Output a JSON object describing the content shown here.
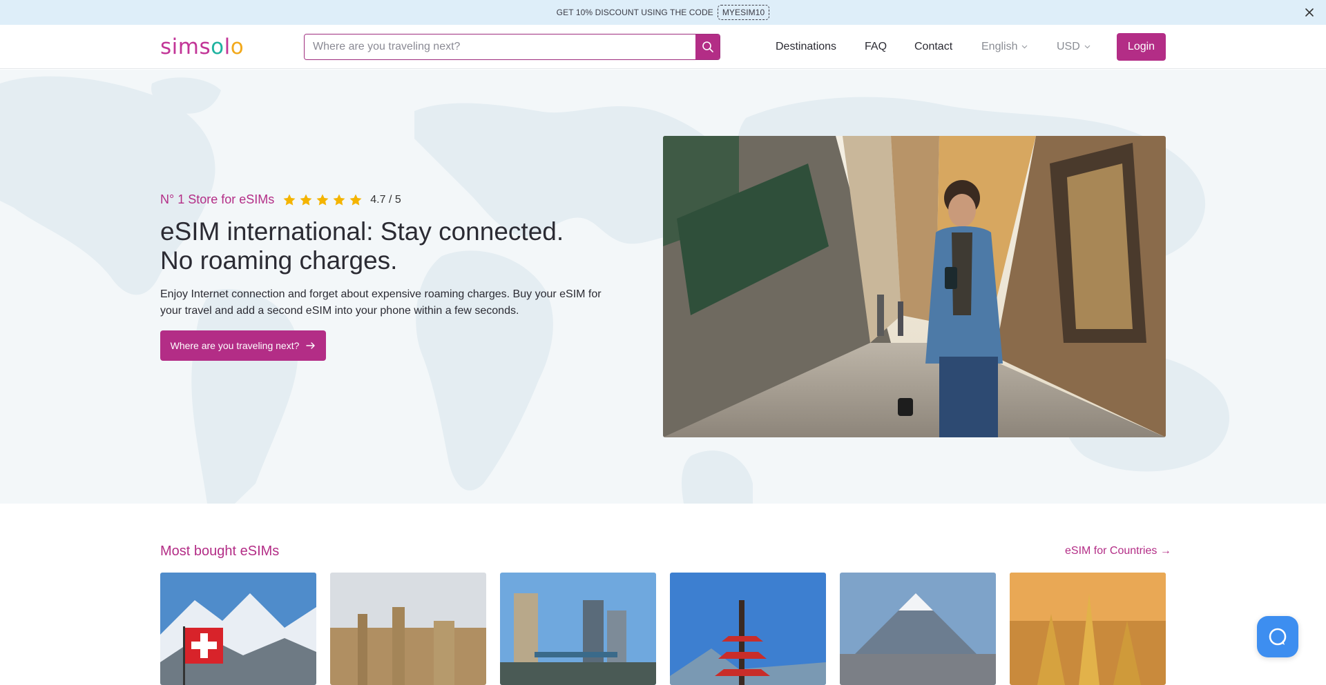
{
  "promo": {
    "text": "GET 10% DISCOUNT USING THE CODE",
    "code": "MYESIM10"
  },
  "header": {
    "logo": {
      "s": "sims",
      "o1": "o",
      "l": "l",
      "o2": "o"
    },
    "search_placeholder": "Where are you traveling next?",
    "nav": {
      "destinations": "Destinations",
      "faq": "FAQ",
      "contact": "Contact",
      "language": "English",
      "currency": "USD"
    },
    "login": "Login"
  },
  "hero": {
    "tagline": "N° 1 Store for eSIMs",
    "stars": 5,
    "rating": "4.7 / 5",
    "title_line1": "eSIM international: Stay connected.",
    "title_line2": "No roaming charges.",
    "description": "Enjoy Internet connection and forget about expensive roaming charges. Buy your eSIM for your travel and add a second eSIM into your phone within a few seconds.",
    "cta": "Where are you traveling next?"
  },
  "most_bought": {
    "title": "Most bought eSIMs",
    "link": "eSIM for Countries →"
  },
  "colors": {
    "brand": "#b32d86",
    "promo_bg": "#deeef9",
    "chat": "#3d8ef0"
  }
}
